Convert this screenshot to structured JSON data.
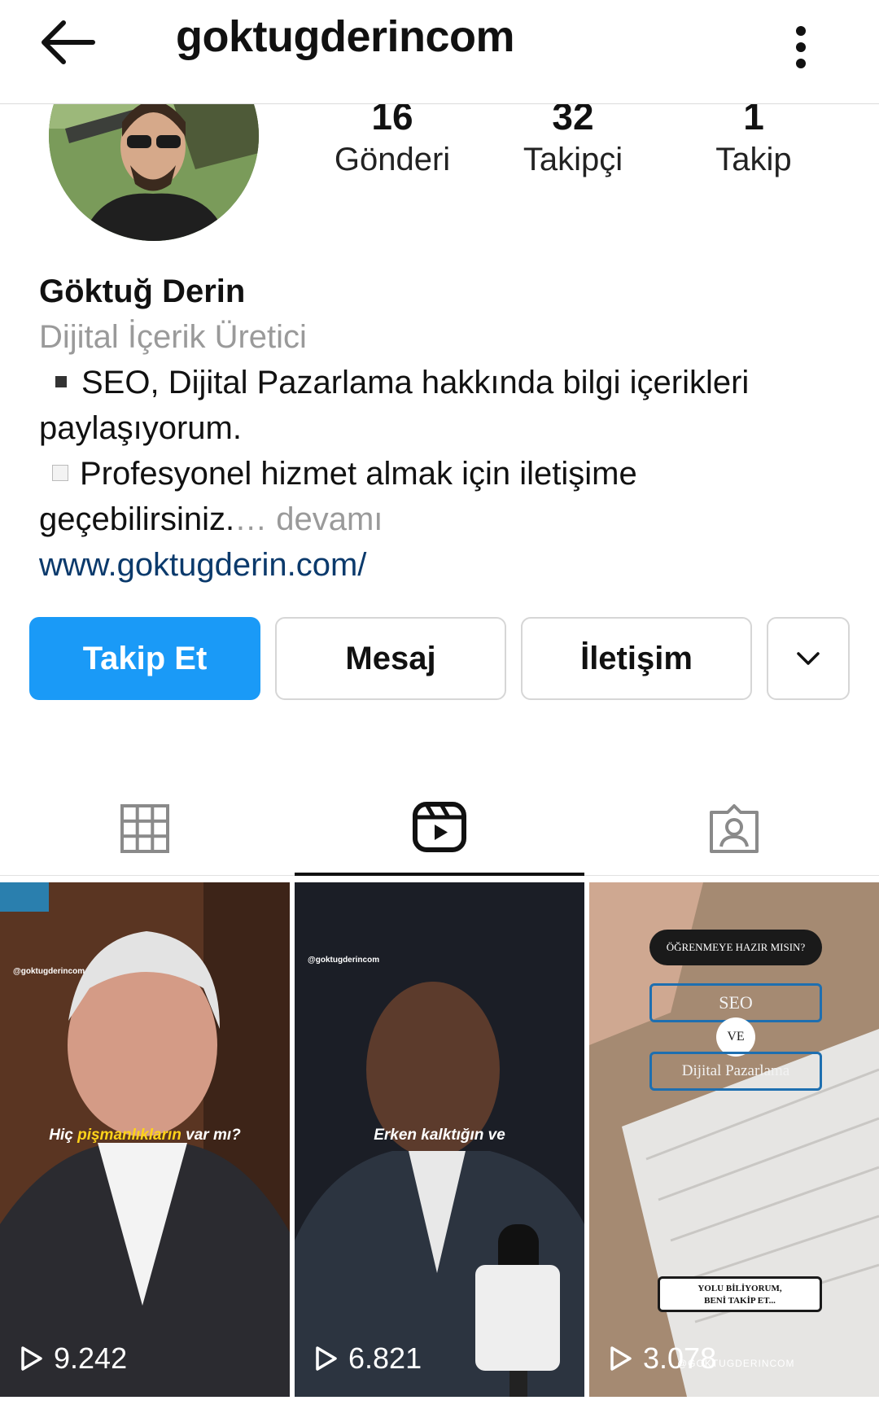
{
  "header": {
    "username": "goktugderincom"
  },
  "stats": [
    {
      "value": "16",
      "label": "Gönderi"
    },
    {
      "value": "32",
      "label": "Takipçi"
    },
    {
      "value": "1",
      "label": "Takip"
    }
  ],
  "bio": {
    "name": "Göktuğ Derin",
    "category": "Dijital İçerik Üretici",
    "line1": "SEO, Dijital Pazarlama hakkında bilgi içerikleri",
    "line2": "paylaşıyorum.",
    "line3": "Profesyonel hizmet almak için iletişime",
    "line4": "geçebilirsiniz.",
    "more": "… devamı",
    "link": "www.goktugderin.com/"
  },
  "buttons": {
    "follow": "Takip Et",
    "message": "Mesaj",
    "contact": "İletişim"
  },
  "colors": {
    "accent": "#1a9af7",
    "link": "#0b3a6c",
    "muted": "#9a9a9a"
  },
  "reels": [
    {
      "views": "9.242",
      "watermark": "@goktugderincom",
      "caption_a": "Hiç ",
      "caption_b": "pişmanlıkların",
      "caption_c": " var mı?"
    },
    {
      "views": "6.821",
      "watermark": "@goktugderincom",
      "caption": "Erken kalktığın ve"
    },
    {
      "views": "3.078",
      "bubble": "ÖĞRENMEYE HAZIR MISIN?",
      "box1": "SEO",
      "circle": "VE",
      "box2": "Dijital Pazarlama",
      "note_line1": "YOLU BİLİYORUM,",
      "note_line2": "BENİ TAKİP ET...",
      "watermark": "@GOKTUGDERINCOM"
    }
  ]
}
